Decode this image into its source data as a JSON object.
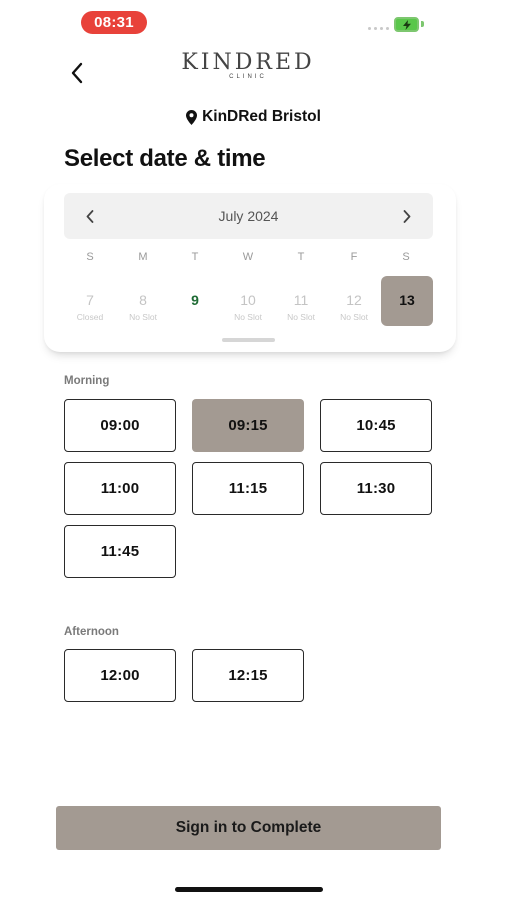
{
  "status_bar": {
    "time": "08:31"
  },
  "header": {
    "logo_text": "KINDRED",
    "logo_subtext": "CLINIC",
    "location_icon": "map-pin-icon",
    "location": "KinDRed Bristol",
    "title": "Select date & time"
  },
  "calendar": {
    "month": "July 2024",
    "weekdays": [
      "S",
      "M",
      "T",
      "W",
      "T",
      "F",
      "S"
    ],
    "days": [
      {
        "num": "7",
        "note": "Closed"
      },
      {
        "num": "8",
        "note": "No Slot"
      },
      {
        "num": "9",
        "note": ""
      },
      {
        "num": "10",
        "note": "No Slot"
      },
      {
        "num": "11",
        "note": "No Slot"
      },
      {
        "num": "12",
        "note": "No Slot"
      },
      {
        "num": "13",
        "note": ""
      }
    ],
    "selected_day": "13",
    "available_color": "#1e6b34"
  },
  "morning": {
    "label": "Morning",
    "slots": [
      "09:00",
      "09:15",
      "10:45",
      "11:00",
      "11:15",
      "11:30",
      "11:45"
    ],
    "selected": "09:15"
  },
  "afternoon": {
    "label": "Afternoon",
    "slots": [
      "12:00",
      "12:15"
    ]
  },
  "cta": {
    "label": "Sign in to Complete"
  },
  "colors": {
    "accent": "#a39a92",
    "status_red": "#e8423a"
  }
}
